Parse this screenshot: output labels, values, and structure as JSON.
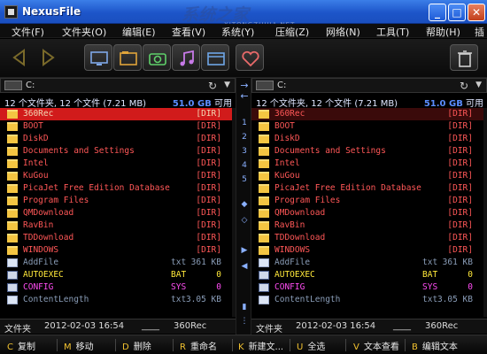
{
  "window": {
    "title": "NexusFile",
    "watermark": "系统之家",
    "watermark_url": "XITONGZHIJIA.NET",
    "min": "_",
    "max": "□",
    "close": "✕"
  },
  "menu": [
    "文件(F)",
    "文件夹(O)",
    "编辑(E)",
    "查看(V)",
    "系统(Y)",
    "压缩(Z)",
    "网络(N)",
    "工具(T)",
    "帮助(H)",
    "插"
  ],
  "toolbar": [
    "back-arrow-icon",
    "forward-arrow-icon",
    "monitor-icon",
    "folder-window-icon",
    "camera-icon",
    "music-note-icon",
    "film-icon",
    "heart-icon",
    "trash-icon"
  ],
  "left": {
    "drive": "C:",
    "path": "",
    "summary": "12 个文件夹, 12 个文件 (7.21 MB)",
    "free_size": "51.0 GB",
    "free_label": "可用",
    "rows": [
      {
        "name": "360Rec",
        "ext": "",
        "size": "[DIR]",
        "type": "dir"
      },
      {
        "name": "BOOT",
        "ext": "",
        "size": "[DIR]",
        "type": "dir"
      },
      {
        "name": "DiskD",
        "ext": "",
        "size": "[DIR]",
        "type": "dir"
      },
      {
        "name": "Documents and Settings",
        "ext": "",
        "size": "[DIR]",
        "type": "dir"
      },
      {
        "name": "Intel",
        "ext": "",
        "size": "[DIR]",
        "type": "dir"
      },
      {
        "name": "KuGou",
        "ext": "",
        "size": "[DIR]",
        "type": "dir"
      },
      {
        "name": "PicaJet Free Edition Database",
        "ext": "",
        "size": "[DIR]",
        "type": "dir"
      },
      {
        "name": "Program Files",
        "ext": "",
        "size": "[DIR]",
        "type": "dir"
      },
      {
        "name": "QMDownload",
        "ext": "",
        "size": "[DIR]",
        "type": "dir"
      },
      {
        "name": "RavBin",
        "ext": "",
        "size": "[DIR]",
        "type": "dir"
      },
      {
        "name": "TDDownload",
        "ext": "",
        "size": "[DIR]",
        "type": "dir"
      },
      {
        "name": "WINDOWS",
        "ext": "",
        "size": "[DIR]",
        "type": "dir"
      },
      {
        "name": "AddFile",
        "ext": "txt",
        "size": "361 KB",
        "type": "txt"
      },
      {
        "name": "AUTOEXEC",
        "ext": "BAT",
        "size": "0",
        "type": "bat"
      },
      {
        "name": "CONFIG",
        "ext": "SYS",
        "size": "0",
        "type": "sys"
      },
      {
        "name": "ContentLength",
        "ext": "txt",
        "size": "3.05 KB",
        "type": "txt"
      }
    ],
    "status": [
      "文件夹",
      "2012-02-03 16:54",
      "____",
      "360Rec"
    ]
  },
  "right": {
    "drive": "C:",
    "path": "",
    "summary": "12 个文件夹, 12 个文件 (7.21 MB)",
    "free_size": "51.0 GB",
    "free_label": "可用",
    "rows": [
      {
        "name": "360Rec",
        "ext": "",
        "size": "[DIR]",
        "type": "dir"
      },
      {
        "name": "BOOT",
        "ext": "",
        "size": "[DIR]",
        "type": "dir"
      },
      {
        "name": "DiskD",
        "ext": "",
        "size": "[DIR]",
        "type": "dir"
      },
      {
        "name": "Documents and Settings",
        "ext": "",
        "size": "[DIR]",
        "type": "dir"
      },
      {
        "name": "Intel",
        "ext": "",
        "size": "[DIR]",
        "type": "dir"
      },
      {
        "name": "KuGou",
        "ext": "",
        "size": "[DIR]",
        "type": "dir"
      },
      {
        "name": "PicaJet Free Edition Database",
        "ext": "",
        "size": "[DIR]",
        "type": "dir"
      },
      {
        "name": "Program Files",
        "ext": "",
        "size": "[DIR]",
        "type": "dir"
      },
      {
        "name": "QMDownload",
        "ext": "",
        "size": "[DIR]",
        "type": "dir"
      },
      {
        "name": "RavBin",
        "ext": "",
        "size": "[DIR]",
        "type": "dir"
      },
      {
        "name": "TDDownload",
        "ext": "",
        "size": "[DIR]",
        "type": "dir"
      },
      {
        "name": "WINDOWS",
        "ext": "",
        "size": "[DIR]",
        "type": "dir"
      },
      {
        "name": "AddFile",
        "ext": "txt",
        "size": "361 KB",
        "type": "txt"
      },
      {
        "name": "AUTOEXEC",
        "ext": "BAT",
        "size": "0",
        "type": "bat"
      },
      {
        "name": "CONFIG",
        "ext": "SYS",
        "size": "0",
        "type": "sys"
      },
      {
        "name": "ContentLength",
        "ext": "txt",
        "size": "3.05 KB",
        "type": "txt"
      }
    ],
    "status": [
      "文件夹",
      "2012-02-03 16:54",
      "____",
      "360Rec"
    ]
  },
  "center": {
    "numbers": [
      "1",
      "2",
      "3",
      "4",
      "5"
    ],
    "arrow_right": "→",
    "arrow_left": "←"
  },
  "fkeys": [
    {
      "key": "C",
      "label": "复制"
    },
    {
      "key": "M",
      "label": "移动"
    },
    {
      "key": "D",
      "label": "删除"
    },
    {
      "key": "R",
      "label": "重命名"
    },
    {
      "key": "K",
      "label": "新建文..."
    },
    {
      "key": "U",
      "label": "全选"
    },
    {
      "key": "V",
      "label": "文本查看"
    },
    {
      "key": "B",
      "label": "编辑文本"
    }
  ]
}
